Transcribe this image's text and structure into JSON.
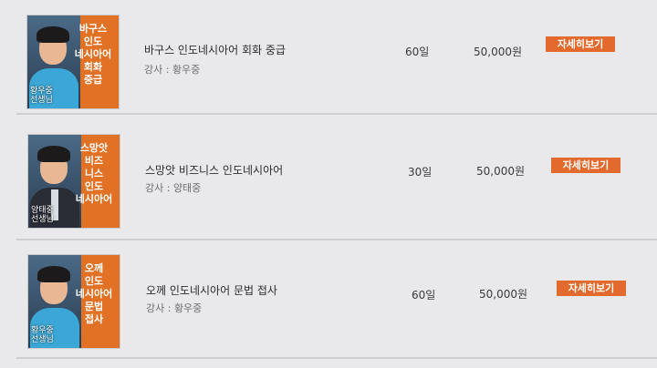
{
  "courses": [
    {
      "thumb_title": "바구스\n인도\n네시아어\n회화\n중급",
      "thumb_caption": "황우중\n선생님",
      "title": "바구스 인도네시아어 회화 중급",
      "instructor": "강사 : 황우중",
      "duration": "60일",
      "price": "50,000원",
      "detail_label": "자세히보기"
    },
    {
      "thumb_title": "스망앗\n비즈\n니스\n인도\n네시아어",
      "thumb_caption": "양태중\n선생님",
      "title": "스망앗 비즈니스 인도네시아어",
      "instructor": "강사 : 양태중",
      "duration": "30일",
      "price": "50,000원",
      "detail_label": "자세히보기"
    },
    {
      "thumb_title": "오께\n인도\n네시아어\n문법\n접사",
      "thumb_caption": "황우중\n선생님",
      "title": "오께 인도네시아어 문법 접사",
      "instructor": "강사 : 황우중",
      "duration": "60일",
      "price": "50,000원",
      "detail_label": "자세히보기"
    }
  ]
}
